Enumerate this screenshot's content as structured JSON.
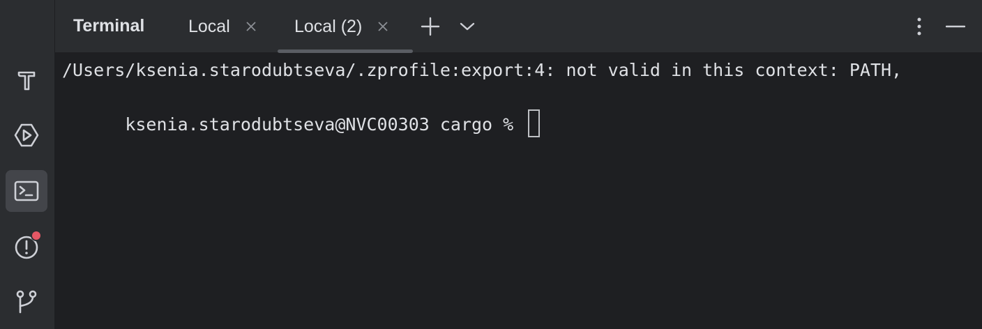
{
  "panel": {
    "title": "Terminal"
  },
  "tabs": [
    {
      "label": "Local",
      "closable": true,
      "active": false
    },
    {
      "label": "Local (2)",
      "closable": true,
      "active": true
    }
  ],
  "header_actions": {
    "new_tab_icon": "plus-icon",
    "tab_dropdown_icon": "chevron-down-icon",
    "more_icon": "more-vertical-icon",
    "minimize_icon": "minimize-icon"
  },
  "tool_stripe": [
    {
      "icon": "hammer-icon",
      "active": false
    },
    {
      "icon": "run-icon",
      "active": false
    },
    {
      "icon": "terminal-icon",
      "active": true
    },
    {
      "icon": "problems-icon",
      "active": false,
      "has_badge": true
    },
    {
      "icon": "git-branch-icon",
      "active": false
    }
  ],
  "terminal": {
    "lines": [
      "/Users/ksenia.starodubtseva/.zprofile:export:4: not valid in this context: PATH,",
      "ksenia.starodubtseva@NVC00303 cargo % "
    ]
  },
  "colors": {
    "background": "#1e1f22",
    "panel": "#2b2d30",
    "text": "#dfe1e5",
    "icon": "#ced0d6",
    "badge": "#e55765"
  }
}
